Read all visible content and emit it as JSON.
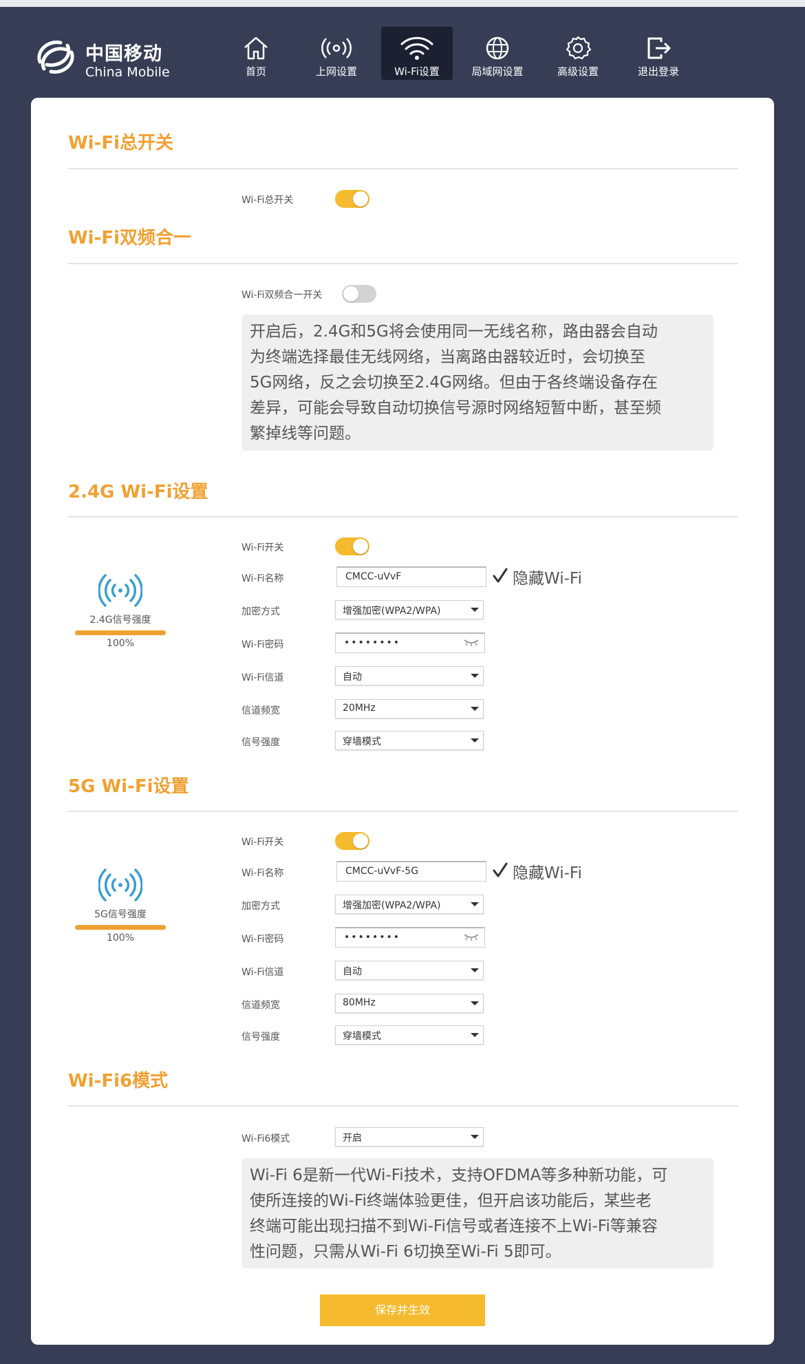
{
  "brand": {
    "name_cn": "中国移动",
    "name_en": "China Mobile",
    "icon": "china-mobile-logo"
  },
  "nav": [
    {
      "label": "首页",
      "icon": "home-icon",
      "active": false
    },
    {
      "label": "上网设置",
      "icon": "broadcast-icon",
      "active": false
    },
    {
      "label": "Wi-Fi设置",
      "icon": "wifi-icon",
      "active": true
    },
    {
      "label": "局域网设置",
      "icon": "globe-icon",
      "active": false
    },
    {
      "label": "高级设置",
      "icon": "gear-icon",
      "active": false
    },
    {
      "label": "退出登录",
      "icon": "logout-icon",
      "active": false
    }
  ],
  "master": {
    "title": "Wi-Fi总开关",
    "switch_label": "Wi-Fi总开关",
    "switch_on": true
  },
  "dual": {
    "title": "Wi-Fi双频合一",
    "switch_label": "Wi-Fi双频合一开关",
    "switch_on": false,
    "info_lines": [
      "开启后，2.4G和5G将会使用同一无线名称，路由器会自动",
      "为终端选择最佳无线网络，当离路由器较近时，会切换至",
      "5G网络，反之会切换至2.4G网络。但由于各终端设备存在",
      "差异，可能会导致自动切换信号源时网络短暂中断，甚至频",
      "繁掉线等问题。"
    ]
  },
  "band24": {
    "title": "2.4G Wi-Fi设置",
    "signal_label": "2.4G信号强度",
    "signal_pct": "100%",
    "signal_value": 1.0,
    "labels": {
      "switch": "Wi-Fi开关",
      "ssid": "Wi-Fi名称",
      "encryption": "加密方式",
      "password": "Wi-Fi密码",
      "channel": "Wi-Fi信道",
      "bandwidth": "信道频宽",
      "strength": "信号强度"
    },
    "switch_on": true,
    "ssid": "CMCC-uVvF",
    "hide_label": "隐藏Wi-Fi",
    "hide_checked": true,
    "encryption": "增强加密(WPA2/WPA)",
    "password": "••••••••",
    "channel": "自动",
    "bandwidth": "20MHz",
    "strength": "穿墙模式"
  },
  "band5": {
    "title": "5G Wi-Fi设置",
    "signal_label": "5G信号强度",
    "signal_pct": "100%",
    "signal_value": 1.0,
    "labels": {
      "switch": "Wi-Fi开关",
      "ssid": "Wi-Fi名称",
      "encryption": "加密方式",
      "password": "Wi-Fi密码",
      "channel": "Wi-Fi信道",
      "bandwidth": "信道频宽",
      "strength": "信号强度"
    },
    "switch_on": true,
    "ssid": "CMCC-uVvF-5G",
    "hide_label": "隐藏Wi-Fi",
    "hide_checked": true,
    "encryption": "增强加密(WPA2/WPA)",
    "password": "••••••••",
    "channel": "自动",
    "bandwidth": "80MHz",
    "strength": "穿墙模式"
  },
  "wifi6": {
    "title": "Wi-Fi6模式",
    "label": "Wi-Fi6模式",
    "value": "开启",
    "info_lines": [
      "Wi-Fi 6是新一代Wi-Fi技术，支持OFDMA等多种新功能，可",
      "使所连接的Wi-Fi终端体验更佳，但开启该功能后，某些老",
      "终端可能出现扫描不到Wi-Fi信号或者连接不上Wi-Fi等兼容",
      "性问题，只需从Wi-Fi 6切换至Wi-Fi 5即可。"
    ]
  },
  "save_label": "保存并生效",
  "colors": {
    "accent": "#f0a132",
    "toggle_on": "#f5ba2d",
    "header_bg": "#363d55",
    "active_tab_bg": "#1c2131",
    "signal_icon": "#3a9fd0"
  }
}
